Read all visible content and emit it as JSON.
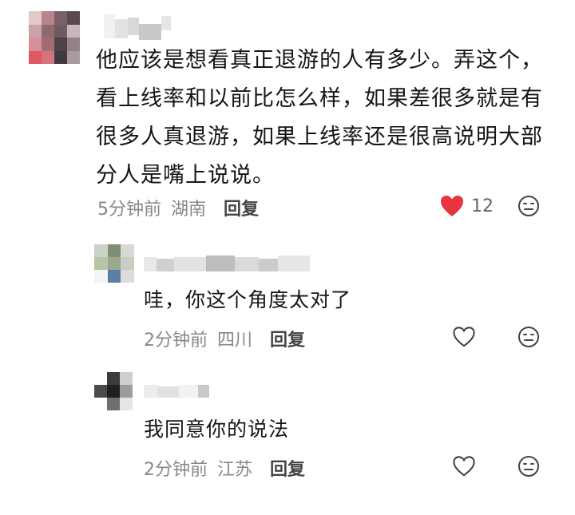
{
  "main_comment": {
    "text": "他应该是想看真正退游的人有多少。弄这个，看上线率和以前比怎么样，如果差很多就是有很多人真退游，如果上线率还是很高说明大部分人是嘴上说说。",
    "time": "5分钟前",
    "location": "湖南",
    "reply_label": "回复",
    "like_count": "12",
    "liked": true
  },
  "replies": [
    {
      "text": "哇，你这个角度太对了",
      "time": "2分钟前",
      "location": "四川",
      "reply_label": "回复"
    },
    {
      "text": "我同意你的说法",
      "time": "2分钟前",
      "location": "江苏",
      "reply_label": "回复"
    }
  ],
  "colors": {
    "like_red": "#e8343c",
    "meta_gray": "#888888",
    "text": "#151515"
  },
  "icons": [
    "heart-filled-icon",
    "heart-outline-icon",
    "dislike-face-icon"
  ]
}
